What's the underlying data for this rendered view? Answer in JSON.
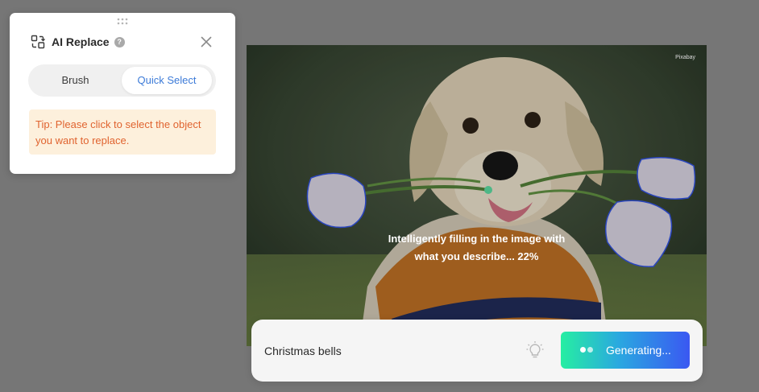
{
  "panel": {
    "title": "AI Replace",
    "tabs": [
      {
        "label": "Brush",
        "active": false
      },
      {
        "label": "Quick Select",
        "active": true
      }
    ],
    "tip": "Tip: Please click to select the object you want to replace."
  },
  "canvas": {
    "progress_line1": "Intelligently filling in the image with",
    "progress_line2": "what you describe... 22%",
    "watermark": "Pixabay"
  },
  "prompt": {
    "value": "Christmas bells",
    "generate_label": "Generating..."
  },
  "colors": {
    "accent": "#3d7bd8",
    "tip_bg": "#fdf0dc",
    "tip_text": "#e0632f",
    "selection_outline": "#2f4fd8"
  },
  "icons": {
    "panel": "ai-replace-icon",
    "help": "question-icon",
    "close": "close-icon",
    "drag": "drag-handle-icon",
    "bulb": "lightbulb-icon"
  }
}
